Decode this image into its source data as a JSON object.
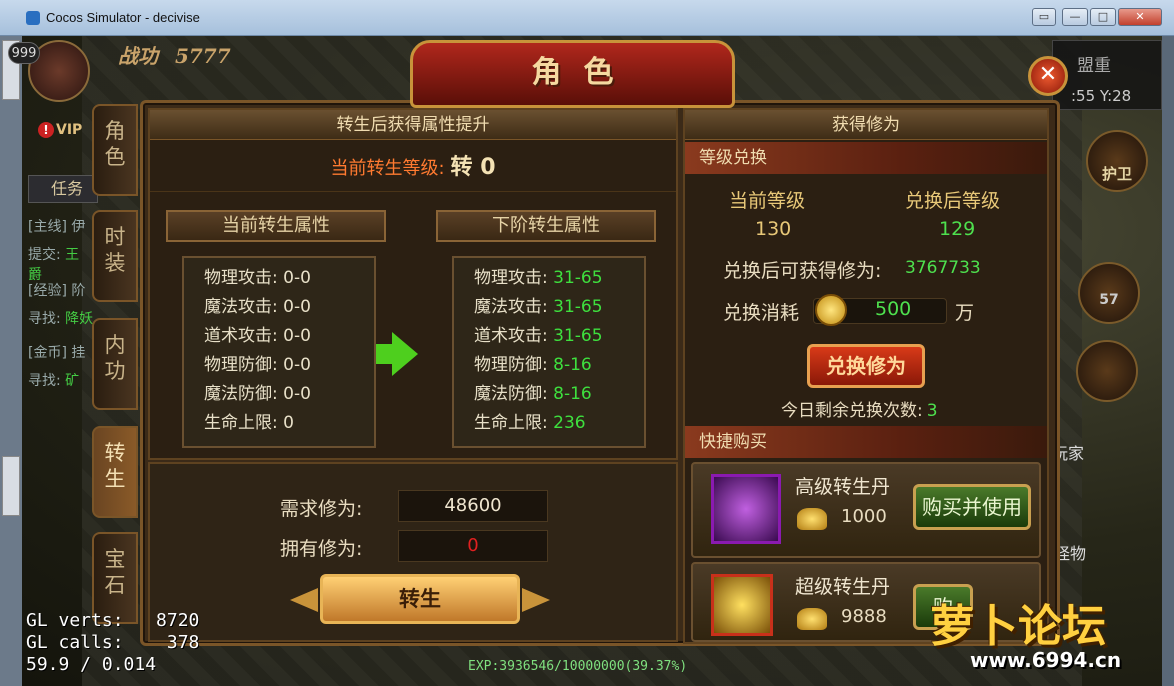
{
  "window": {
    "title": "Cocos Simulator - decivise",
    "controls": [
      "▭",
      "—",
      "□",
      "✕"
    ]
  },
  "hud": {
    "level": "999",
    "power_label": "战功",
    "power_value": "5777",
    "vip": "VIP",
    "task_tab": "任务",
    "quests": [
      {
        "tag": "[主线]",
        "text": "伊"
      },
      {
        "tag": "提交:",
        "text": "王"
      },
      {
        "tag": "",
        "text": "爵"
      },
      {
        "tag": "[经验]",
        "text": "阶"
      },
      {
        "tag": "寻找:",
        "text": "降妖"
      },
      {
        "tag": "[金币]",
        "text": "挂"
      },
      {
        "tag": "寻找:",
        "text": "矿"
      }
    ],
    "map_name": "盟重",
    "coords": ":55 Y:28",
    "guard_label": "护卫",
    "skill_count": "57",
    "players_label": "玩家",
    "monsters_label": "怪物",
    "exp_text": "EXP:3936546/10000000(39.37%)"
  },
  "debug": {
    "line1": "GL verts:   8720",
    "line2": "GL calls:    378",
    "line3": "59.9 / 0.014"
  },
  "watermark": {
    "text": "萝卜论坛",
    "url": "www.6994.cn"
  },
  "panel": {
    "title": "角色",
    "close_icon": "✕",
    "tabs": [
      "角色",
      "时装",
      "内功",
      "转生",
      "宝石"
    ],
    "active_tab": "转生",
    "left": {
      "heading": "转生后获得属性提升",
      "current_level_label": "当前转生等级:",
      "current_level_value": "转 0",
      "current_attr_title": "当前转生属性",
      "next_attr_title": "下阶转生属性",
      "current_attrs": [
        {
          "label": "物理攻击:",
          "value": "0-0"
        },
        {
          "label": "魔法攻击:",
          "value": "0-0"
        },
        {
          "label": "道术攻击:",
          "value": "0-0"
        },
        {
          "label": "物理防御:",
          "value": "0-0"
        },
        {
          "label": "魔法防御:",
          "value": "0-0"
        },
        {
          "label": "生命上限:",
          "value": "0"
        }
      ],
      "next_attrs": [
        {
          "label": "物理攻击:",
          "value": "31-65"
        },
        {
          "label": "魔法攻击:",
          "value": "31-65"
        },
        {
          "label": "道术攻击:",
          "value": "31-65"
        },
        {
          "label": "物理防御:",
          "value": "8-16"
        },
        {
          "label": "魔法防御:",
          "value": "8-16"
        },
        {
          "label": "生命上限:",
          "value": "236"
        }
      ],
      "required_label": "需求修为:",
      "required_value": "48600",
      "owned_label": "拥有修为:",
      "owned_value": "0",
      "rebirth_button": "转生"
    },
    "right": {
      "heading": "获得修为",
      "exchange_section": "等级兑换",
      "current_level_label": "当前等级",
      "after_level_label": "兑换后等级",
      "current_level": "130",
      "after_level": "129",
      "gain_label": "兑换后可获得修为:",
      "gain_value": "3767733",
      "cost_label": "兑换消耗",
      "cost_value": "500",
      "cost_unit": "万",
      "exchange_button": "兑换修为",
      "remaining_label": "今日剩余兑换次数:",
      "remaining_value": "3",
      "quick_buy_section": "快捷购买",
      "items": [
        {
          "name": "高级转生丹",
          "price": "1000",
          "button": "购买并使用"
        },
        {
          "name": "超级转生丹",
          "price": "9888",
          "button": "购"
        }
      ]
    }
  },
  "colors": {
    "green_value": "#3ee03e",
    "red_value": "#e02020",
    "accent_gold": "#c8933a"
  }
}
